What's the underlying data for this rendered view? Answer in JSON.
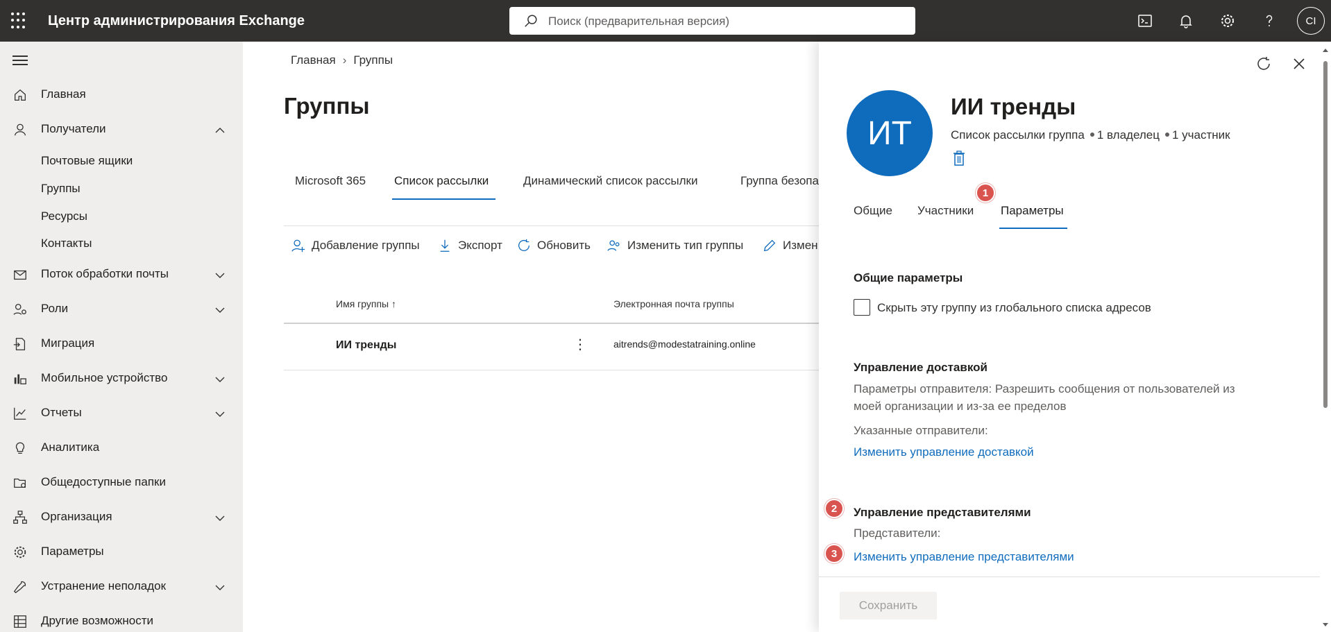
{
  "app": {
    "title": "Центр администрирования Exchange"
  },
  "search": {
    "placeholder": "Поиск (предварительная версия)"
  },
  "user": {
    "initials": "CI"
  },
  "sidebar": {
    "items": [
      {
        "label": "Главная",
        "icon": "home-icon"
      },
      {
        "label": "Получатели",
        "icon": "person-icon",
        "expanded": true
      },
      {
        "label": "Поток обработки почты",
        "icon": "mail-icon"
      },
      {
        "label": "Роли",
        "icon": "roles-icon"
      },
      {
        "label": "Миграция",
        "icon": "migration-icon"
      },
      {
        "label": "Мобильное устройство",
        "icon": "mobile-icon"
      },
      {
        "label": "Отчеты",
        "icon": "chart-icon"
      },
      {
        "label": "Аналитика",
        "icon": "bulb-icon"
      },
      {
        "label": "Общедоступные папки",
        "icon": "folder-icon"
      },
      {
        "label": "Организация",
        "icon": "org-icon"
      },
      {
        "label": "Параметры",
        "icon": "gear-icon"
      },
      {
        "label": "Устранение неполадок",
        "icon": "wrench-icon"
      },
      {
        "label": "Другие возможности",
        "icon": "grid-icon"
      }
    ],
    "sub_items": [
      "Почтовые ящики",
      "Группы",
      "Ресурсы",
      "Контакты"
    ]
  },
  "breadcrumb": {
    "home": "Главная",
    "current": "Группы"
  },
  "page": {
    "title": "Группы"
  },
  "tabs": [
    "Microsoft 365",
    "Список рассылки",
    "Динамический список рассылки",
    "Группа безопа"
  ],
  "toolbar": {
    "add_group": "Добавление группы",
    "export": "Экспорт",
    "refresh": "Обновить",
    "change_type": "Изменить тип группы",
    "edit": "Измен"
  },
  "table": {
    "headers": {
      "name": "Имя группы",
      "email": "Электронная почта группы"
    },
    "rows": [
      {
        "name": "ИИ тренды",
        "email": "aitrends@modestatraining.online"
      }
    ]
  },
  "panel": {
    "avatar_initials": "ИТ",
    "title": "ИИ тренды",
    "type": "Список рассылки группа",
    "owners": "1 владелец",
    "members": "1 участник",
    "tabs": [
      "Общие",
      "Участники",
      "Параметры"
    ],
    "general_settings": {
      "heading": "Общие параметры",
      "hide_label": "Скрыть эту группу из глобального списка адресов"
    },
    "delivery": {
      "heading": "Управление доставкой",
      "senders_text": "Параметры отправителя: Разрешить сообщения от пользователей из моей организации и из-за ее пределов",
      "specified": "Указанные отправители:",
      "link": "Изменить управление доставкой"
    },
    "delegates": {
      "heading": "Управление представителями",
      "label": "Представители:",
      "link": "Изменить управление представителями"
    },
    "save": "Сохранить"
  },
  "badges": {
    "b1": "1",
    "b2": "2",
    "b3": "3"
  },
  "colors": {
    "accent": "#0f6cbd",
    "topbar": "#323130",
    "badge": "#d9534f"
  }
}
